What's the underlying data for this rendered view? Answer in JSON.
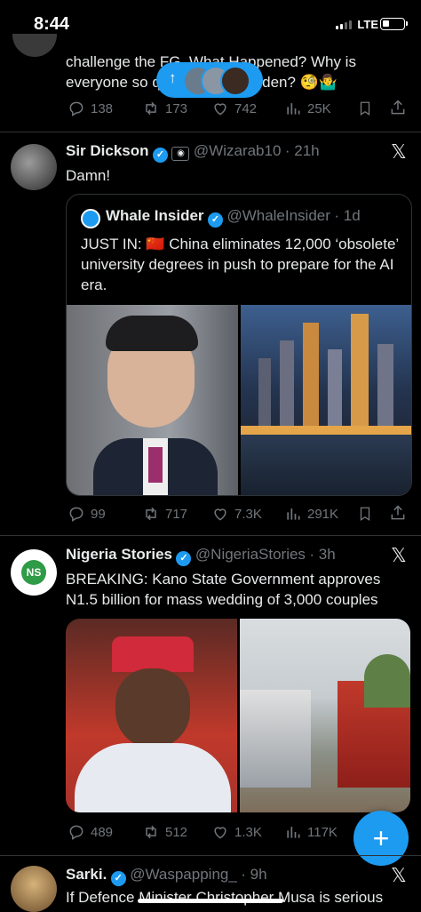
{
  "status_bar": {
    "time": "8:44",
    "network": "LTE"
  },
  "new_posts_pill": {
    "arrow": "↑"
  },
  "tweets": [
    {
      "text": "challenge the FG. What Happened? Why is everyone so quiet all of a sudden? 🧐🤷‍♂️",
      "line1": "challenge the FG. What Happened? Why is",
      "line2": "everyone so quiet all of a sudden? 🧐🤷‍♂️",
      "replies": "138",
      "reposts": "173",
      "likes": "742",
      "views": "25K"
    },
    {
      "name": "Sir Dickson",
      "handle": "@Wizarab10",
      "time": "· 21h",
      "text": "Damn!",
      "quote": {
        "name": "Whale Insider",
        "handle": "@WhaleInsider",
        "time": "· 1d",
        "text": "JUST IN: 🇨🇳 China eliminates 12,000 ‘obsolete’ university degrees in push to prepare for the AI era."
      },
      "replies": "99",
      "reposts": "717",
      "likes": "7.3K",
      "views": "291K"
    },
    {
      "name": "Nigeria Stories",
      "handle": "@NigeriaStories",
      "time": "· 3h",
      "text": "BREAKING: Kano State Government approves N1.5 billion for mass wedding of 3,000 couples",
      "avatar_text": "NS",
      "replies": "489",
      "reposts": "512",
      "likes": "1.3K",
      "views": "117K"
    },
    {
      "name": "Sarki.",
      "handle": "@Waspapping_",
      "time": "· 9h",
      "text": "If Defence Minister Christopher Musa is serious"
    }
  ],
  "fab": {
    "label": "+"
  },
  "colors": {
    "accent": "#1d9bf0",
    "background": "#000000",
    "muted": "#71767b",
    "divider": "#2f3336"
  }
}
